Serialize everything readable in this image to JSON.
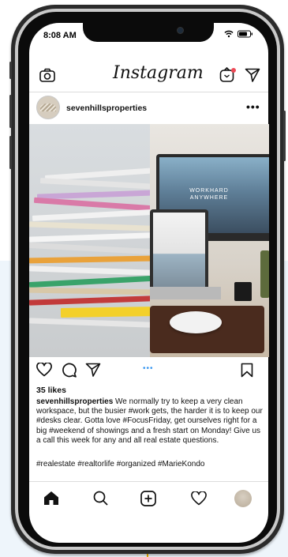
{
  "status_bar": {
    "time": "8:08 AM"
  },
  "header": {
    "logo": "Instagram"
  },
  "post": {
    "username": "sevenhillsproperties",
    "more": "•••",
    "image_text": "WORKHARD ANYWHERE",
    "carousel_dots": "•••",
    "likes": "35 likes",
    "caption_username": "sevenhillsproperties",
    "caption_text": "We normally try to keep a very clean workspace, but the busier #work gets, the harder it is to keep our #desks clear. Gotta love #FocusFriday, get ourselves right for a big #weekend of showings and a fresh start on Monday! Give us a call this week for any and all real estate questions.",
    "hashtags": "#realestate #realtorlife #organized #MarieKondo"
  },
  "icons": {
    "camera": "camera-icon",
    "igtv": "igtv-icon",
    "direct": "direct-message-icon",
    "like": "heart-icon",
    "comment": "comment-icon",
    "share": "share-icon",
    "save": "bookmark-icon",
    "home": "home-icon",
    "search": "search-icon",
    "add": "add-post-icon",
    "activity": "heart-icon"
  },
  "colors": {
    "dot_active": "#3897f0",
    "notification": "#ed4956",
    "accent_line": "#f0b100"
  }
}
